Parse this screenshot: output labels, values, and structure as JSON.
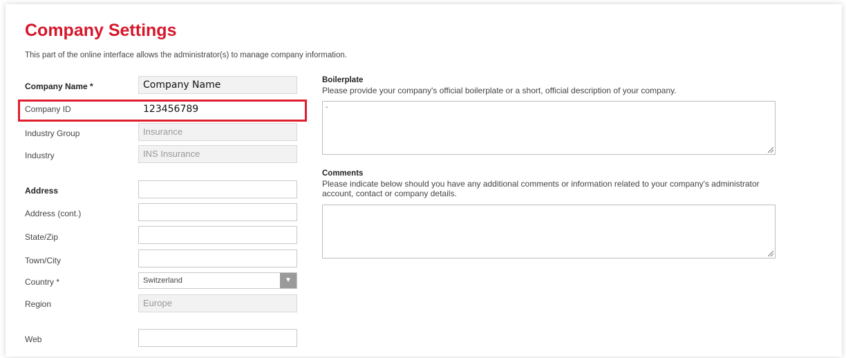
{
  "page": {
    "title": "Company Settings",
    "intro": "This part of the online interface allows the administrator(s) to manage company information."
  },
  "fields": {
    "company_name": {
      "label": "Company Name *",
      "value": "Company Name"
    },
    "company_id": {
      "label": "Company ID",
      "value": "123456789"
    },
    "industry_group": {
      "label": "Industry Group",
      "value": "Insurance"
    },
    "industry": {
      "label": "Industry",
      "value": "INS Insurance"
    },
    "address": {
      "label": "Address",
      "value": ""
    },
    "address_cont": {
      "label": "Address (cont.)",
      "value": ""
    },
    "state_zip": {
      "label": "State/Zip",
      "value": ""
    },
    "town_city": {
      "label": "Town/City",
      "value": ""
    },
    "country": {
      "label": "Country *",
      "value": "Switzerland",
      "arrow": "▼"
    },
    "region": {
      "label": "Region",
      "value": "Europe"
    },
    "web": {
      "label": "Web",
      "value": ""
    }
  },
  "boilerplate": {
    "heading": "Boilerplate",
    "description": "Please provide your company's official boilerplate or a short, official description of your company.",
    "value": "-"
  },
  "comments": {
    "heading": "Comments",
    "description": "Please indicate below should you have any additional comments or information related to your company's administrator account, contact or company details.",
    "value": ""
  },
  "colors": {
    "accent": "#d6162b",
    "highlight_border": "#e01e2e"
  }
}
